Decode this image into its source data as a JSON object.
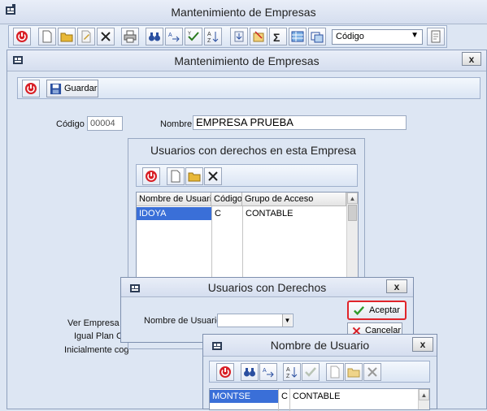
{
  "main_window": {
    "title": "Mantenimiento de Empresas",
    "code_select": "Código"
  },
  "inner_window": {
    "title": "Mantenimiento de Empresas",
    "close": "x",
    "save_label": "Guardar",
    "codigo_label": "Código",
    "codigo_value": "00004",
    "nombre_label": "Nombre",
    "nombre_value": "EMPRESA PRUEBA",
    "side_labels": [
      "Ver Empresa en F",
      "Igual Plan Co",
      "Inicialmente cog"
    ]
  },
  "usuarios_panel": {
    "title": "Usuarios con derechos en esta Empresa",
    "columns": [
      "Nombre de Usuario",
      "Código",
      "Grupo de Acceso"
    ],
    "rows": [
      {
        "usuario": "IDOYA",
        "codigo": "C",
        "grupo": "CONTABLE"
      }
    ]
  },
  "derechos_dialog": {
    "title": "Usuarios con Derechos",
    "close": "x",
    "field_label": "Nombre de Usuario",
    "field_value": "",
    "accept_label": "Aceptar",
    "cancel_label": "Cancelar"
  },
  "nombre_dialog": {
    "title": "Nombre de Usuario",
    "close": "x",
    "rows": [
      {
        "usuario": "MONTSE",
        "codigo": "C",
        "grupo": "CONTABLE"
      }
    ]
  },
  "colors": {
    "accent": "#3a6fd8",
    "highlight_border": "#e0242a",
    "background": "#dde6f3"
  }
}
